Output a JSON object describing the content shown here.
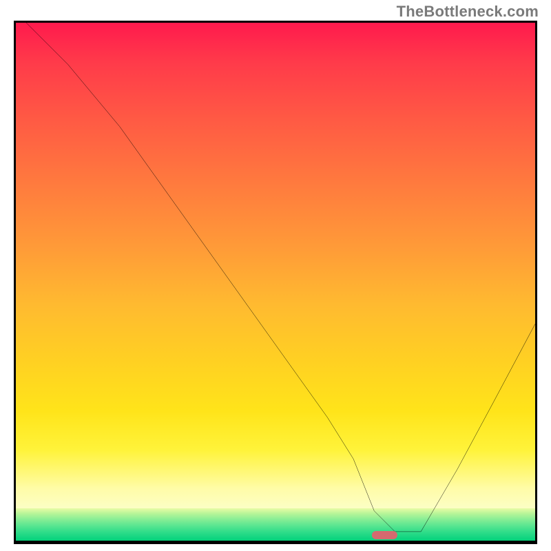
{
  "watermark": "TheBottleneck.com",
  "chart_data": {
    "type": "line",
    "title": "",
    "xlabel": "",
    "ylabel": "",
    "xlim": [
      0,
      100
    ],
    "ylim": [
      0,
      100
    ],
    "grid": false,
    "legend": false,
    "series": [
      {
        "name": "curve",
        "x": [
          2,
          10,
          20,
          25,
          30,
          40,
          50,
          60,
          65,
          69,
          73,
          78,
          85,
          92,
          100
        ],
        "y": [
          100,
          92,
          80,
          73,
          66,
          52,
          38,
          24,
          16,
          6,
          2,
          2,
          14,
          27,
          42
        ]
      }
    ],
    "background_gradient": {
      "type": "vertical",
      "stops": [
        {
          "pct": 0,
          "color": "#ff1a4d"
        },
        {
          "pct": 20,
          "color": "#ff5a44"
        },
        {
          "pct": 45,
          "color": "#ff9a38"
        },
        {
          "pct": 70,
          "color": "#ffd122"
        },
        {
          "pct": 88,
          "color": "#fff33a"
        },
        {
          "pct": 93.5,
          "color": "#fcfec4"
        },
        {
          "pct": 94,
          "color": "#e9fca6"
        },
        {
          "pct": 100,
          "color": "#00cd76"
        }
      ]
    },
    "marker": {
      "shape": "capsule",
      "color": "#d46a6f",
      "x": 71,
      "y": 1.3
    }
  },
  "colors": {
    "border": "#000000",
    "curve": "#000000",
    "marker": "#d46a6f",
    "watermark": "#7a7a7a"
  }
}
